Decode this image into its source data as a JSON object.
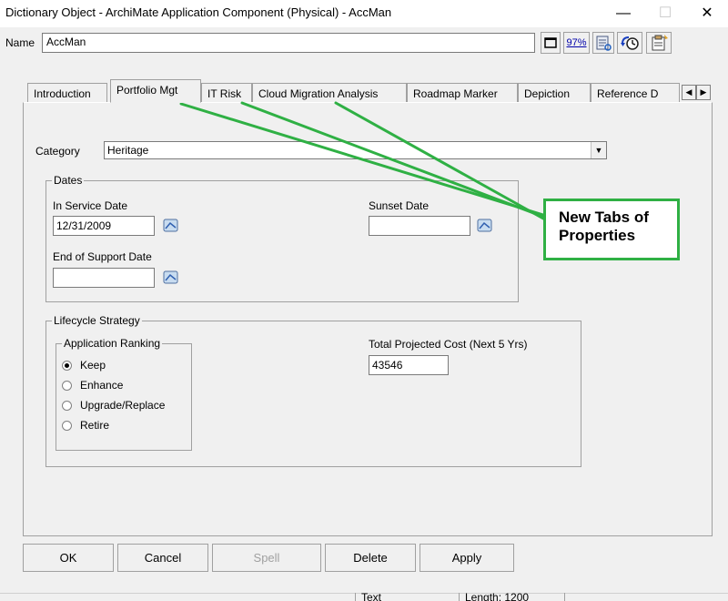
{
  "window": {
    "title": "Dictionary Object - ArchiMate Application Component (Physical) - AccMan",
    "minimize_glyph": "—",
    "maximize_glyph": "☐",
    "close_glyph": "✕"
  },
  "name_row": {
    "label": "Name",
    "value": "AccMan",
    "zoom": "97%",
    "icons": [
      "restore-box-icon",
      "zoom-icon",
      "report-icon",
      "history-icon",
      "properties-icon"
    ]
  },
  "tabs": [
    {
      "label": "Introduction"
    },
    {
      "label": "Portfolio Mgt",
      "active": true
    },
    {
      "label": "IT Risk"
    },
    {
      "label": "Cloud Migration Analysis"
    },
    {
      "label": "Roadmap Marker"
    },
    {
      "label": "Depiction"
    },
    {
      "label": "Reference D"
    }
  ],
  "form": {
    "category_label": "Category",
    "category_value": "Heritage",
    "dates": {
      "legend": "Dates",
      "in_service_label": "In Service Date",
      "in_service_value": "12/31/2009",
      "sunset_label": "Sunset Date",
      "sunset_value": "",
      "end_support_label": "End of Support Date",
      "end_support_value": ""
    },
    "lifecycle": {
      "legend": "Lifecycle Strategy",
      "ranking_legend": "Application Ranking",
      "options": [
        {
          "label": "Keep",
          "checked": true
        },
        {
          "label": "Enhance",
          "checked": false
        },
        {
          "label": "Upgrade/Replace",
          "checked": false
        },
        {
          "label": "Retire",
          "checked": false
        }
      ],
      "cost_label": "Total Projected Cost (Next 5 Yrs)",
      "cost_value": "43546"
    }
  },
  "callout": {
    "line1": "New Tabs of",
    "line2": "Properties",
    "color": "#2fb044"
  },
  "buttons": {
    "ok": "OK",
    "cancel": "Cancel",
    "spell": "Spell",
    "delete": "Delete",
    "apply": "Apply"
  },
  "status": {
    "mode": "Text",
    "length": "Length: 1200"
  }
}
